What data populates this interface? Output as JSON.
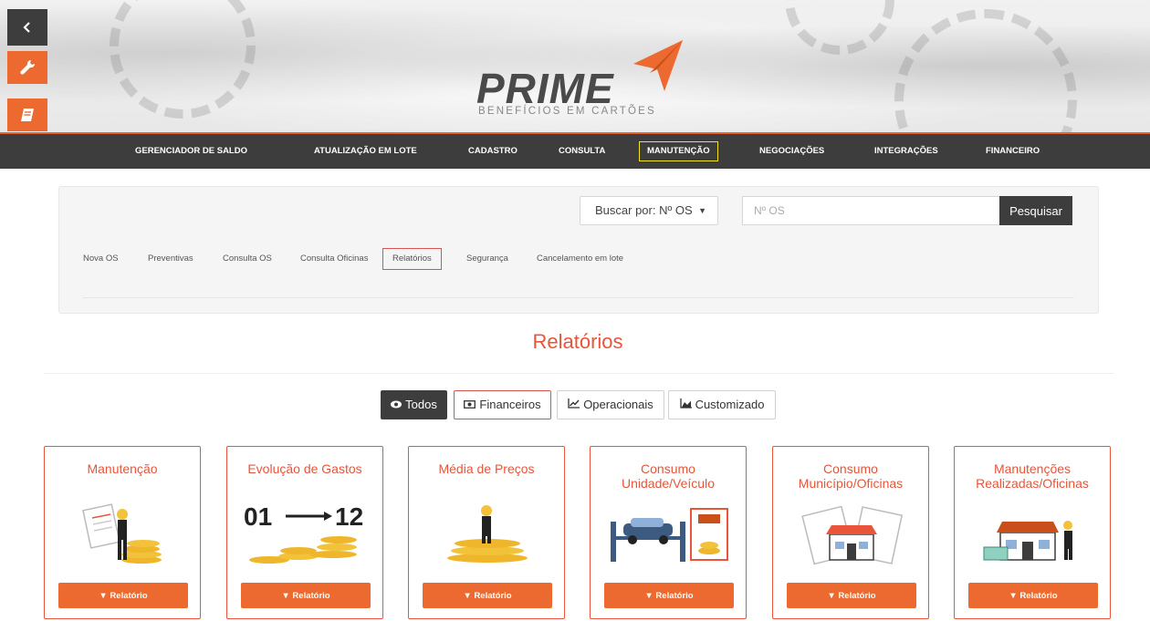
{
  "brand": {
    "name": "PRIME",
    "tagline": "BENEFÍCIOS EM CARTÕES",
    "accent": "#e8632b",
    "nav_bg": "#3d3d3d"
  },
  "sidebar": {
    "items": [
      {
        "icon": "chevron-left-icon"
      },
      {
        "icon": "wrench-icon"
      },
      {
        "icon": "book-icon"
      }
    ]
  },
  "nav": {
    "items": [
      {
        "label": "GERENCIADOR DE SALDO"
      },
      {
        "label": "ATUALIZAÇÃO EM LOTE"
      },
      {
        "label": "CADASTRO"
      },
      {
        "label": "CONSULTA"
      },
      {
        "label": "MANUTENÇÃO",
        "active": true
      },
      {
        "label": "NEGOCIAÇÕES"
      },
      {
        "label": "INTEGRAÇÕES"
      },
      {
        "label": "FINANCEIRO"
      }
    ]
  },
  "search": {
    "select_value": "Buscar por: Nº OS",
    "placeholder": "Nº OS",
    "button": "Pesquisar"
  },
  "subnav": {
    "items": [
      {
        "label": "Nova OS"
      },
      {
        "label": "Preventivas"
      },
      {
        "label": "Consulta OS"
      },
      {
        "label": "Consulta Oficinas"
      },
      {
        "label": "Relatórios",
        "active": true
      },
      {
        "label": "Segurança"
      },
      {
        "label": "Cancelamento em lote"
      }
    ]
  },
  "page": {
    "title": "Relatórios"
  },
  "filters": [
    {
      "label": "Todos",
      "icon": "eye-icon",
      "active": true
    },
    {
      "label": "Financeiros",
      "icon": "money-icon"
    },
    {
      "label": "Operacionais",
      "icon": "line-chart-icon"
    },
    {
      "label": "Customizado",
      "icon": "area-chart-icon"
    }
  ],
  "cards": [
    {
      "title": "Manutenção",
      "button": "Relatório"
    },
    {
      "title": "Evolução de Gastos",
      "button": "Relatório",
      "art_text": [
        "01",
        "12"
      ]
    },
    {
      "title": "Média de Preços",
      "button": "Relatório"
    },
    {
      "title": "Consumo Unidade/Veículo",
      "button": "Relatório"
    },
    {
      "title": "Consumo Município/Oficinas",
      "button": "Relatório"
    },
    {
      "title": "Manutenções Realizadas/Oficinas",
      "button": "Relatório"
    }
  ]
}
